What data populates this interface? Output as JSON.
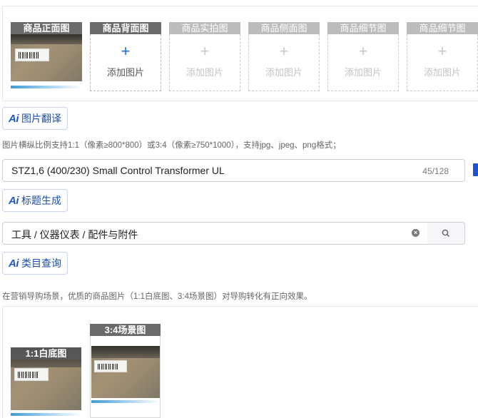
{
  "image_slots": [
    {
      "caption": "商品正面图",
      "state": "filled"
    },
    {
      "caption": "商品背面图",
      "state": "add-active",
      "add_label": "添加图片"
    },
    {
      "caption": "商品实拍图",
      "state": "add-disabled",
      "add_label": "添加图片"
    },
    {
      "caption": "商品侧面图",
      "state": "add-disabled",
      "add_label": "添加图片"
    },
    {
      "caption": "商品细节图",
      "state": "add-disabled",
      "add_label": "添加图片"
    },
    {
      "caption": "商品细节图",
      "state": "add-disabled",
      "add_label": "添加图片"
    }
  ],
  "ai_buttons": {
    "ai_text": "Ai",
    "translate": "图片翻译",
    "title_gen": "标题生成",
    "category": "类目查询"
  },
  "image_hint": "图片横纵比例支持1:1（像素≥800*800）或3:4（像素≥750*1000），支持jpg、jpeg、png格式；",
  "title_input": {
    "value": "STZ1,6 (400/230) Small Control Transformer UL",
    "counter": "45/128"
  },
  "category_input": {
    "value": "工具 / 仪器仪表 / 配件与附件"
  },
  "marketing_hint": "在营销导购场景，优质的商品图片（1:1白底图、3:4场景图）对导购转化有正向效果。",
  "marketing_slots": [
    {
      "caption": "1:1白底图"
    },
    {
      "caption": "3:4场景图"
    }
  ],
  "colors": {
    "accent": "#1d56c8",
    "caption_dark": "#6b6b6b",
    "caption_light": "#bcbcbc"
  }
}
